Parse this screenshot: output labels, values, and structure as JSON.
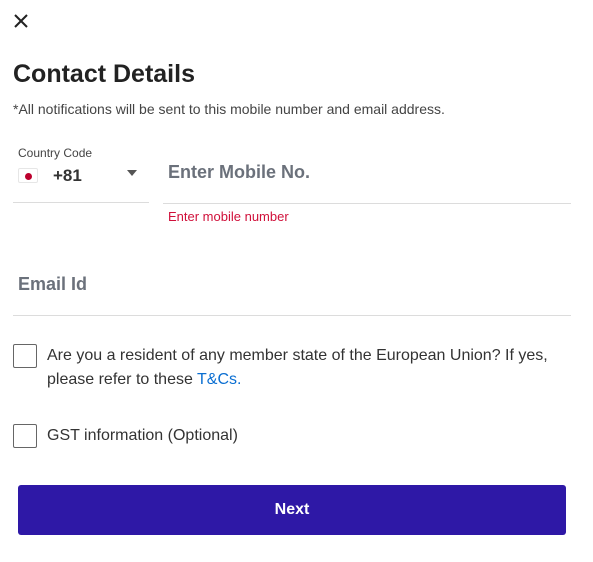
{
  "header": {
    "close_icon": "close-icon",
    "title": "Contact Details",
    "subtitle": "*All notifications will be sent to this mobile number and email address."
  },
  "country_code": {
    "label": "Country Code",
    "flag_icon": "japan-flag-icon",
    "value": "+81",
    "dropdown_icon": "caret-down-icon"
  },
  "mobile": {
    "placeholder": "Enter Mobile No.",
    "value": "",
    "error": "Enter mobile number"
  },
  "email": {
    "placeholder": "Email Id",
    "value": ""
  },
  "eu_resident": {
    "checked": false,
    "text": "Are you a resident of any member state of the European Union? If yes, please refer to these ",
    "link_text": "T&Cs."
  },
  "gst": {
    "checked": false,
    "text": "GST information (Optional)"
  },
  "actions": {
    "next_label": "Next"
  },
  "colors": {
    "primary_button": "#2e18a6",
    "error": "#d0103a",
    "link": "#0a6ed1"
  }
}
